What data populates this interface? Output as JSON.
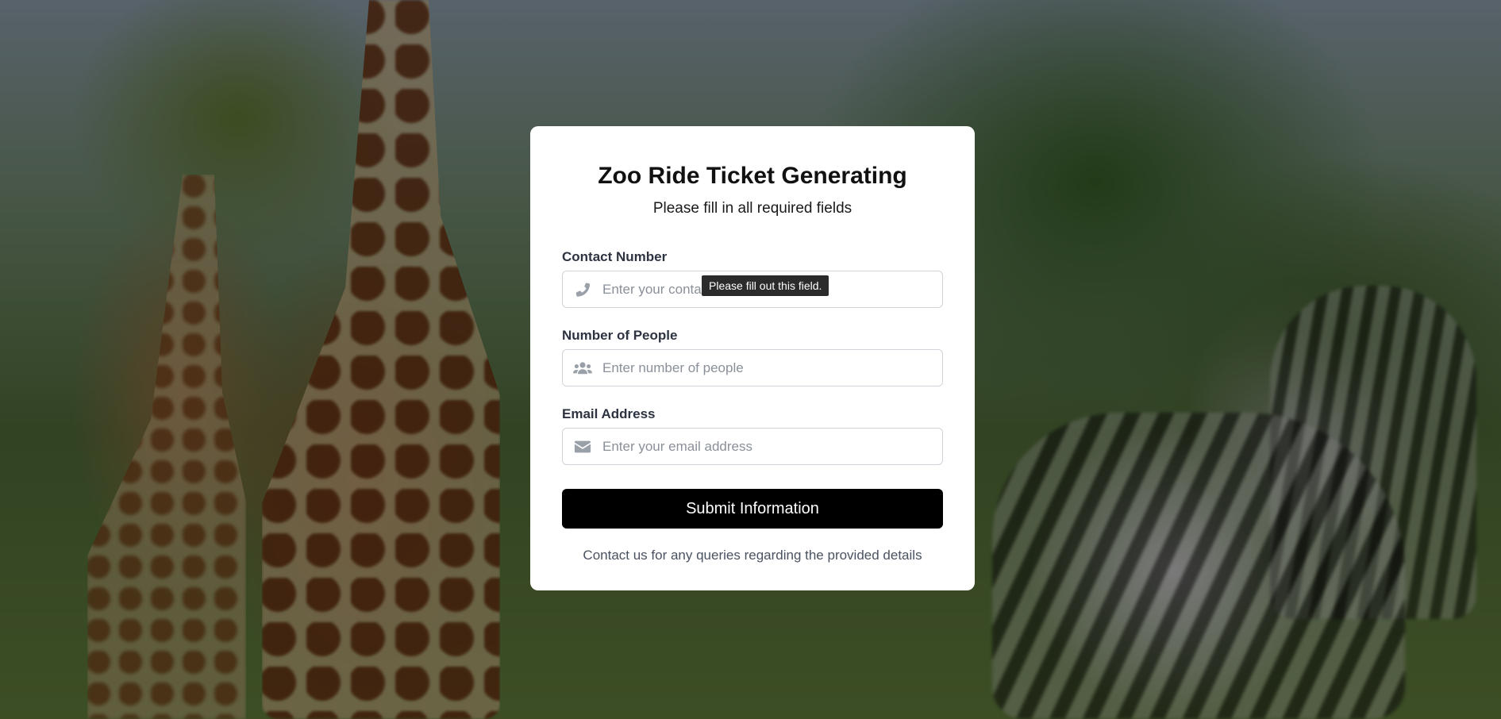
{
  "form": {
    "title": "Zoo Ride Ticket Generating",
    "subtitle": "Please fill in all required fields",
    "fields": [
      {
        "label": "Contact Number",
        "placeholder": "Enter your contact number",
        "value": "",
        "icon": "phone-icon"
      },
      {
        "label": "Number of People",
        "placeholder": "Enter number of people",
        "value": "",
        "icon": "users-icon"
      },
      {
        "label": "Email Address",
        "placeholder": "Enter your email address",
        "value": "",
        "icon": "envelope-icon"
      }
    ],
    "validation_tooltip": "Please fill out this field.",
    "submit_label": "Submit Information",
    "footer_note": "Contact us for any queries regarding the provided details"
  },
  "colors": {
    "card_background": "#ffffff",
    "button_background": "#000000",
    "button_text": "#ffffff",
    "icon_color": "#9aa0a8",
    "tooltip_background": "#2b2b2b"
  }
}
